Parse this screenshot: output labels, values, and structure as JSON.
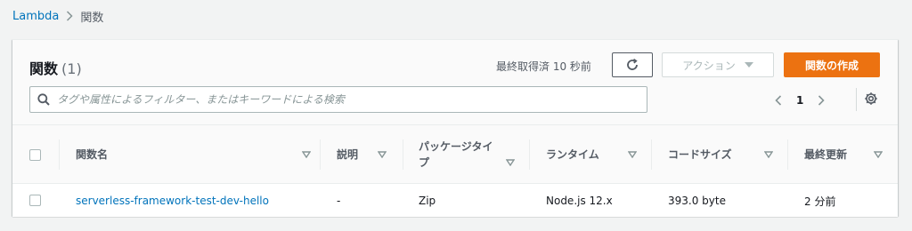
{
  "breadcrumb": {
    "root": "Lambda",
    "current": "関数"
  },
  "header": {
    "title": "関数",
    "count": "(1)",
    "last_fetched": "最終取得済 10 秒前",
    "actions_label": "アクション",
    "create_label": "関数の作成"
  },
  "search": {
    "placeholder": "タグや属性によるフィルター、またはキーワードによる検索",
    "value": ""
  },
  "pagination": {
    "current_page": "1"
  },
  "table": {
    "columns": [
      "関数名",
      "説明",
      "パッケージタイプ",
      "ランタイム",
      "コードサイズ",
      "最終更新"
    ],
    "rows": [
      {
        "name": "serverless-framework-test-dev-hello",
        "description": "-",
        "package_type": "Zip",
        "runtime": "Node.js 12.x",
        "code_size": "393.0 byte",
        "last_modified": "2 分前"
      }
    ]
  },
  "colors": {
    "accent": "#ec7211",
    "link": "#0073bb",
    "background": "#f2f3f3"
  },
  "icons": [
    "chevron-right-icon",
    "refresh-icon",
    "caret-down-icon",
    "search-icon",
    "chevron-left-icon",
    "gear-icon",
    "sort-icon"
  ]
}
